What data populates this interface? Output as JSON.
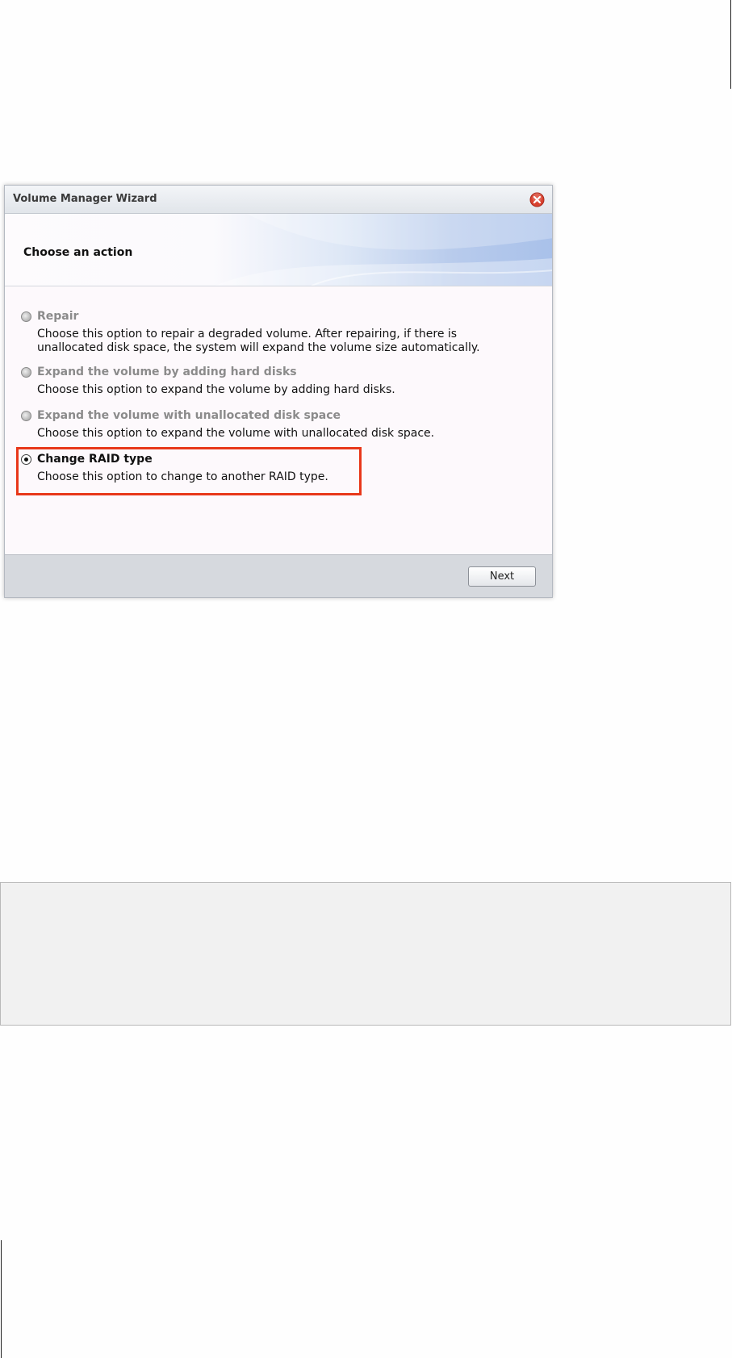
{
  "dialog": {
    "title": "Volume Manager Wizard",
    "header_title": "Choose an action",
    "options": [
      {
        "label": "Repair",
        "description": "Choose this option to repair a degraded volume. After repairing, if there is unallocated disk space, the system will expand the volume size automatically.",
        "enabled": false,
        "selected": false
      },
      {
        "label": "Expand the volume by adding hard disks",
        "description": "Choose this option to expand the volume by adding hard disks.",
        "enabled": false,
        "selected": false
      },
      {
        "label": "Expand the volume with unallocated disk space",
        "description": "Choose this option to expand the volume with unallocated disk space.",
        "enabled": false,
        "selected": false
      },
      {
        "label": "Change RAID type",
        "description": "Choose this option to change to another RAID type.",
        "enabled": true,
        "selected": true
      }
    ],
    "next_label": "Next"
  },
  "colors": {
    "highlight": "#e8381a",
    "close_icon": "#d9412f",
    "header_gradient_end": "#a9c1ea"
  },
  "icons": {
    "close": "close-icon"
  }
}
